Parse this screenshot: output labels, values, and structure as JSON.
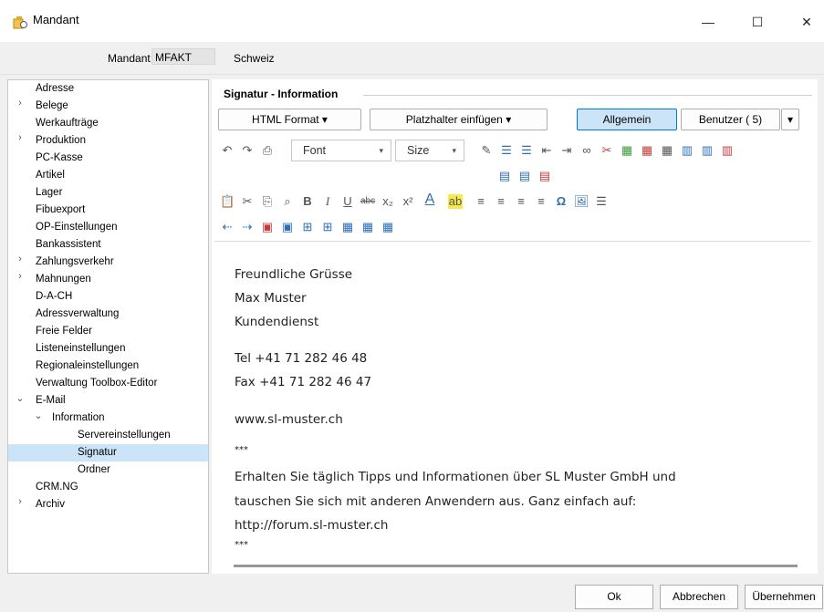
{
  "window": {
    "title": "Mandant",
    "minimize": "—",
    "maximize": "☐",
    "close": "✕"
  },
  "header": {
    "mandant_label": "Mandant",
    "mandant_value": "MFAKT",
    "mandant_name": "Schweiz"
  },
  "tree": [
    {
      "label": "Adresse"
    },
    {
      "label": "Belege",
      "caret": "›"
    },
    {
      "label": "Werkaufträge"
    },
    {
      "label": "Produktion",
      "caret": "›"
    },
    {
      "label": "PC-Kasse"
    },
    {
      "label": "Artikel"
    },
    {
      "label": "Lager"
    },
    {
      "label": "Fibuexport"
    },
    {
      "label": "OP-Einstellungen"
    },
    {
      "label": "Bankassistent"
    },
    {
      "label": "Zahlungsverkehr",
      "caret": "›"
    },
    {
      "label": "Mahnungen",
      "caret": "›"
    },
    {
      "label": "D-A-CH"
    },
    {
      "label": "Adressverwaltung"
    },
    {
      "label": "Freie Felder"
    },
    {
      "label": "Listeneinstellungen"
    },
    {
      "label": "Regionaleinstellungen"
    },
    {
      "label": "Verwaltung Toolbox-Editor"
    },
    {
      "label": "E-Mail",
      "caret": "⌄"
    },
    {
      "label": "Information",
      "caret": "⌄"
    },
    {
      "label": "Servereinstellungen"
    },
    {
      "label": "Signatur"
    },
    {
      "label": "Ordner"
    },
    {
      "label": "CRM.NG"
    },
    {
      "label": "Archiv",
      "caret": "›"
    }
  ],
  "group": {
    "title": "Signatur - Information"
  },
  "buttons": {
    "html_format": "HTML Format ▾",
    "platzhalter": "Platzhalter einfügen ▾",
    "allgemein": "Allgemein",
    "benutzer": "Benutzer ( 5)",
    "benutzer_dd": "▾"
  },
  "toolbar": {
    "font_label": "Font",
    "size_label": "Size",
    "dd": "▾"
  },
  "editor": {
    "lines": [
      "Freundliche Grüsse",
      "Max Muster",
      "Kundendienst",
      "Tel +41 71 282 46 48",
      "Fax +41 71 282 46 47",
      "www.sl-muster.ch",
      "***",
      "Erhalten Sie täglich Tipps und Informationen über SL Muster GmbH und",
      "tauschen Sie sich mit anderen Anwendern aus. Ganz einfach auf:",
      "http://forum.sl-muster.ch",
      "***"
    ]
  },
  "footer": {
    "ok": "Ok",
    "abbrechen": "Abbrechen",
    "uebernehmen": "Übernehmen"
  },
  "colors": {
    "accent": "#0078d7",
    "selection": "#cce4f7"
  }
}
